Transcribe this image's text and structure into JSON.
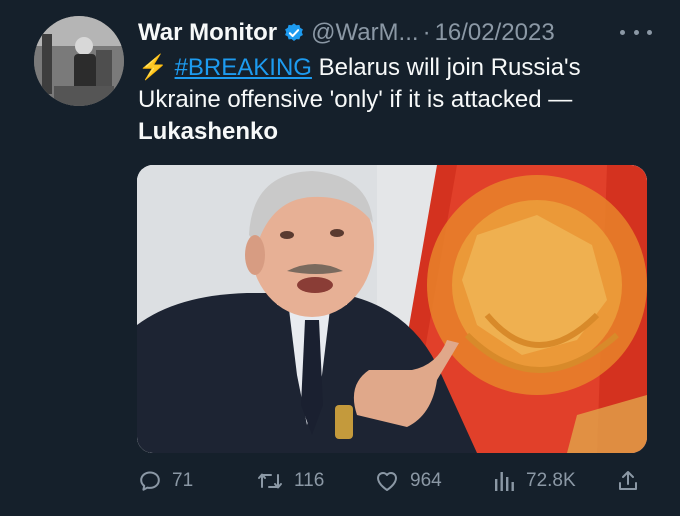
{
  "tweet": {
    "author_name": "War Monitor",
    "handle": "@WarM...",
    "separator": "·",
    "date": "16/02/2023",
    "bolt": "⚡",
    "hashtag": "#BREAKING",
    "text_main": " Belarus will join Russia's Ukraine offensive 'only' if it is attacked —",
    "text_bold": "Lukashenko"
  },
  "actions": {
    "replies": "71",
    "retweets": "116",
    "likes": "964",
    "views": "72.8K"
  },
  "colors": {
    "background": "#15202b",
    "text": "#f7f9f9",
    "muted": "#8b98a5",
    "link": "#1d9bf0",
    "verified": "#1d9bf0"
  },
  "icons": {
    "verified": "verified-badge-icon",
    "more": "more-icon",
    "reply": "reply-icon",
    "retweet": "retweet-icon",
    "like": "like-icon",
    "views": "views-icon",
    "share": "share-icon"
  }
}
